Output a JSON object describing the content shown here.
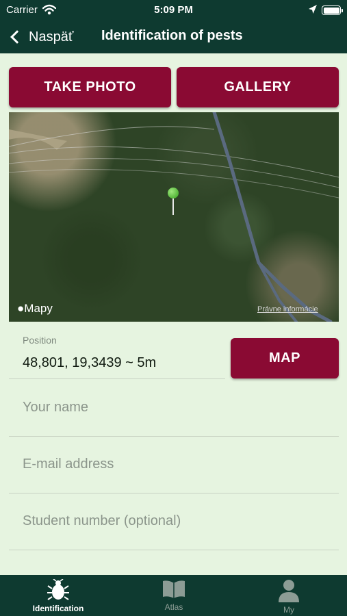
{
  "status_bar": {
    "carrier": "Carrier",
    "time": "5:09 PM",
    "icons": [
      "wifi-icon",
      "location-arrow-icon",
      "battery-icon"
    ]
  },
  "nav": {
    "back_label": "Naspäť",
    "title": "Identification of pests"
  },
  "actions": {
    "take_photo": "TAKE PHOTO",
    "gallery": "GALLERY"
  },
  "map": {
    "logo_text": "Mapy",
    "legal_text": "Právne informácie",
    "pin_color": "#4caf2f",
    "road_color": "#5a6a80"
  },
  "position": {
    "label": "Position",
    "value": "48,801, 19,3439 ~ 5m",
    "map_button": "MAP"
  },
  "form": {
    "name_placeholder": "Your name",
    "email_placeholder": "E-mail address",
    "student_placeholder": "Student number (optional)"
  },
  "tabs": [
    {
      "label": "Identification",
      "icon": "beetle-icon",
      "active": true
    },
    {
      "label": "Atlas",
      "icon": "book-icon",
      "active": false
    },
    {
      "label": "My",
      "icon": "user-icon",
      "active": false
    }
  ],
  "colors": {
    "header_bg": "#0e3a30",
    "page_bg": "#e6f4e0",
    "accent": "#8a0a33",
    "tab_active": "#ffffff",
    "tab_inactive": "#8c9c95"
  }
}
